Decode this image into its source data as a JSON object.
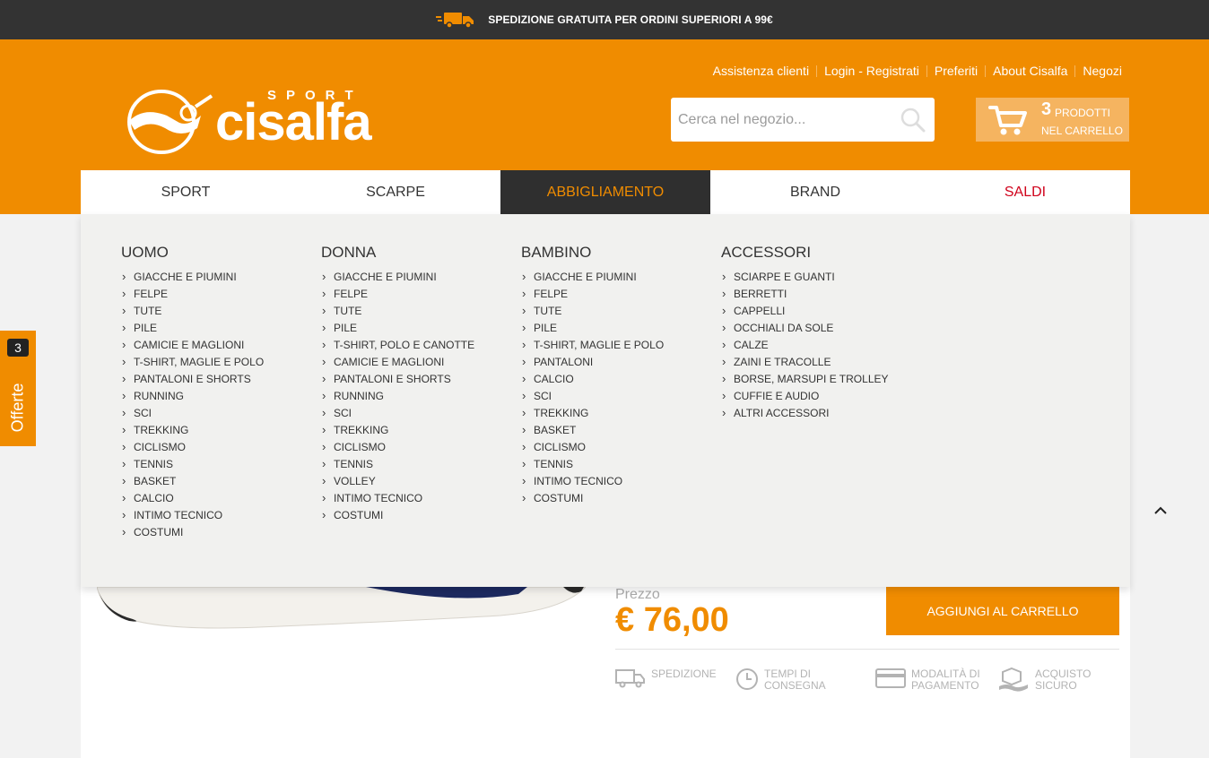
{
  "promo": {
    "text": "SPEDIZIONE GRATUITA PER ORDINI SUPERIORI A 99€",
    "icon": "delivery-truck-icon"
  },
  "header": {
    "links": [
      "Assistenza clienti",
      "Login - Registrati",
      "Preferiti",
      "About Cisalfa",
      "Negozi"
    ],
    "logo": {
      "brand": "cisalfa",
      "sport": "SPORT"
    },
    "search": {
      "placeholder": "Cerca nel negozio...",
      "value": ""
    },
    "cart": {
      "count": "3",
      "line1": "PRODOTTI",
      "line2": "NEL CARRELLO"
    }
  },
  "nav": {
    "items": [
      {
        "label": "SPORT"
      },
      {
        "label": "SCARPE"
      },
      {
        "label": "ABBIGLIAMENTO"
      },
      {
        "label": "BRAND"
      },
      {
        "label": "SALDI"
      }
    ]
  },
  "mega": {
    "columns": [
      {
        "title": "UOMO",
        "items": [
          "GIACCHE E PIUMINI",
          "FELPE",
          "TUTE",
          "PILE",
          "CAMICIE E MAGLIONI",
          "T-SHIRT, MAGLIE E POLO",
          "PANTALONI E SHORTS",
          "RUNNING",
          "SCI",
          "TREKKING",
          "CICLISMO",
          "TENNIS",
          "BASKET",
          "CALCIO",
          "INTIMO TECNICO",
          "COSTUMI"
        ]
      },
      {
        "title": "DONNA",
        "items": [
          "GIACCHE E PIUMINI",
          "FELPE",
          "TUTE",
          "PILE",
          "T-SHIRT, POLO E CANOTTE",
          "CAMICIE E MAGLIONI",
          "PANTALONI E SHORTS",
          "RUNNING",
          "SCI",
          "TREKKING",
          "CICLISMO",
          "TENNIS",
          "VOLLEY",
          "INTIMO TECNICO",
          "COSTUMI"
        ]
      },
      {
        "title": "BAMBINO",
        "items": [
          "GIACCHE E PIUMINI",
          "FELPE",
          "TUTE",
          "PILE",
          "T-SHIRT, MAGLIE E POLO",
          "PANTALONI",
          "CALCIO",
          "SCI",
          "TREKKING",
          "BASKET",
          "CICLISMO",
          "TENNIS",
          "INTIMO TECNICO",
          "COSTUMI"
        ]
      },
      {
        "title": "ACCESSORI",
        "items": [
          "SCIARPE E GUANTI",
          "BERRETTI",
          "CAPPELLI",
          "OCCHIALI DA SOLE",
          "CALZE",
          "ZAINI E TRACOLLE",
          "BORSE, MARSUPI E TROLLEY",
          "CUFFIE E AUDIO",
          "ALTRI ACCESSORI"
        ]
      }
    ]
  },
  "product": {
    "price_label": "Prezzo",
    "price": "€ 76,00",
    "add_to_cart": "AGGIUNGI AL CARRELLO",
    "info": [
      {
        "line1": "SPEDIZIONE",
        "line2": "",
        "icon": "truck-icon"
      },
      {
        "line1": "TEMPI DI",
        "line2": "CONSEGNA",
        "icon": "clock-icon"
      },
      {
        "line1": "MODALITÀ DI",
        "line2": "PAGAMENTO",
        "icon": "credit-card-icon"
      },
      {
        "line1": "ACQUISTO",
        "line2": "SICURO",
        "icon": "secure-package-icon"
      }
    ]
  },
  "offerte": {
    "count": "3",
    "label": "Offerte"
  },
  "colors": {
    "brand_orange": "#f08c00",
    "dark": "#333333",
    "sale_red": "#d0021b"
  }
}
